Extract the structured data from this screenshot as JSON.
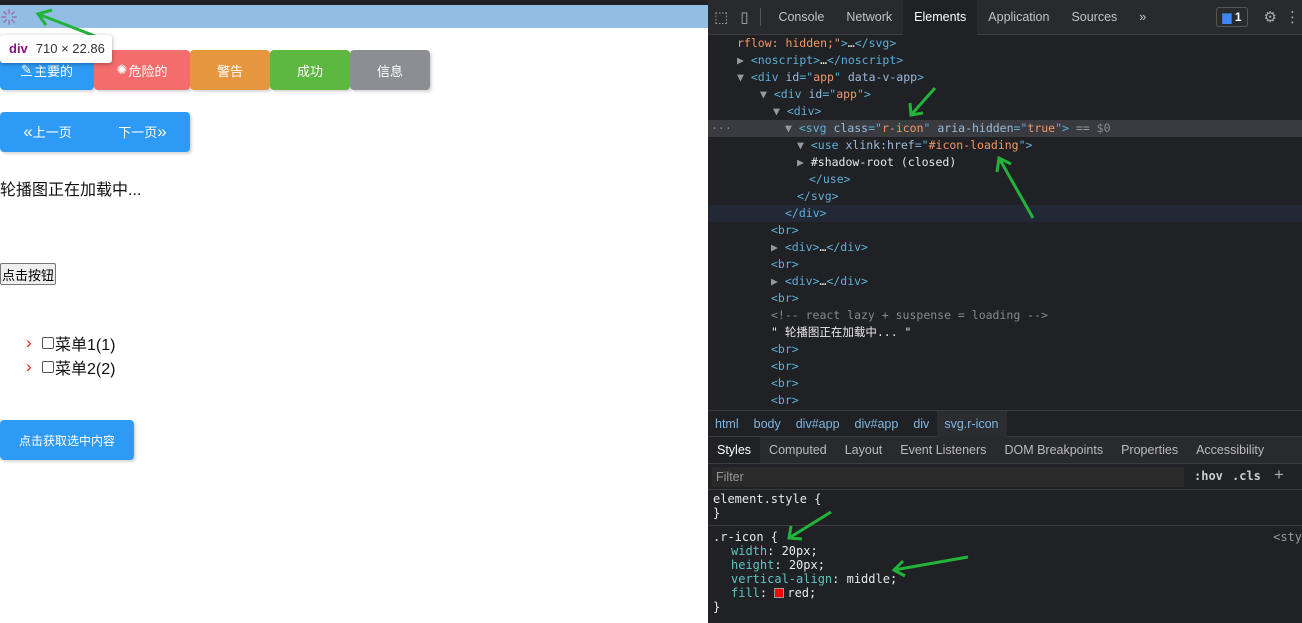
{
  "page": {
    "tooltip": {
      "tag": "div",
      "size": "710 × 22.86"
    },
    "buttons": [
      {
        "label": "主要的",
        "color": "#2d9bf5",
        "icon": "pencil-icon"
      },
      {
        "label": "危险的",
        "color": "#f56c6c",
        "icon": "loading-icon"
      },
      {
        "label": "警告",
        "color": "#e6963f"
      },
      {
        "label": "成功",
        "color": "#5cb840"
      },
      {
        "label": "信息",
        "color": "#8d8e93"
      }
    ],
    "pager": {
      "prev": "上一页",
      "next": "下一页"
    },
    "loading_text": "轮播图正在加载中...",
    "native_button": "点击按钮",
    "menu": [
      {
        "label": "菜单1(1)",
        "checked": false
      },
      {
        "label": "菜单2(2)",
        "checked": false
      }
    ],
    "get_button": "点击获取选中内容"
  },
  "devtools": {
    "tabs": [
      "Console",
      "Network",
      "Elements",
      "Application",
      "Sources"
    ],
    "active_tab": "Elements",
    "more": "»",
    "issues_count": "1",
    "tree": [
      [
        [
          "av",
          "rflow: hidden;\""
        ],
        [
          "tag",
          ">"
        ],
        [
          "tx",
          "…"
        ],
        [
          "tag",
          "</svg>"
        ]
      ],
      [
        [
          "mk",
          "▶ "
        ],
        [
          "tag",
          "<noscript>"
        ],
        [
          "tx",
          "…"
        ],
        [
          "tag",
          "</noscript>"
        ]
      ],
      [
        [
          "mk",
          "▼ "
        ],
        [
          "tag",
          "<div "
        ],
        [
          "an",
          "id"
        ],
        [
          "tag",
          "=\""
        ],
        [
          "av",
          "app"
        ],
        [
          "tag",
          "\" "
        ],
        [
          "an",
          "data-v-app"
        ],
        [
          "tag",
          ">"
        ]
      ],
      [
        [
          "mk",
          "▼ "
        ],
        [
          "tag",
          "<div "
        ],
        [
          "an",
          "id"
        ],
        [
          "tag",
          "=\""
        ],
        [
          "av",
          "app"
        ],
        [
          "tag",
          "\">"
        ]
      ],
      [
        [
          "mk",
          "▼ "
        ],
        [
          "tag",
          "<div>"
        ]
      ],
      [
        [
          "mk",
          "▼ "
        ],
        [
          "tag",
          "<svg "
        ],
        [
          "an",
          "class"
        ],
        [
          "tag",
          "=\""
        ],
        [
          "av",
          "r-icon"
        ],
        [
          "tag",
          "\" "
        ],
        [
          "an",
          "aria-hidden"
        ],
        [
          "tag",
          "=\""
        ],
        [
          "av",
          "true"
        ],
        [
          "tag",
          "\">"
        ],
        [
          "mk",
          " == "
        ],
        [
          "cm",
          "$0"
        ]
      ],
      [
        [
          "mk",
          "▼ "
        ],
        [
          "tag",
          "<use "
        ],
        [
          "an",
          "xlink:href"
        ],
        [
          "tag",
          "=\""
        ],
        [
          "av",
          "#icon-loading"
        ],
        [
          "tag",
          "\">"
        ]
      ],
      [
        [
          "mk",
          "▶ "
        ],
        [
          "tx",
          "#shadow-root (closed)"
        ]
      ],
      [
        [
          "tag",
          "</use>"
        ]
      ],
      [
        [
          "tag",
          "</svg>"
        ]
      ],
      [
        [
          "tag",
          "</div>"
        ]
      ],
      [
        [
          "tag",
          "<br>"
        ]
      ],
      [
        [
          "mk",
          "▶ "
        ],
        [
          "tag",
          "<div>"
        ],
        [
          "tx",
          "…"
        ],
        [
          "tag",
          "</div>"
        ]
      ],
      [
        [
          "tag",
          "<br>"
        ]
      ],
      [
        [
          "mk",
          "▶ "
        ],
        [
          "tag",
          "<div>"
        ],
        [
          "tx",
          "…"
        ],
        [
          "tag",
          "</div>"
        ]
      ],
      [
        [
          "tag",
          "<br>"
        ]
      ],
      [
        [
          "cm",
          "<!-- react lazy + suspense = loading -->"
        ]
      ],
      [
        [
          "tx",
          "\" 轮播图正在加载中... \""
        ]
      ],
      [
        [
          "tag",
          "<br>"
        ]
      ],
      [
        [
          "tag",
          "<br>"
        ]
      ],
      [
        [
          "tag",
          "<br>"
        ]
      ],
      [
        [
          "tag",
          "<br>"
        ]
      ]
    ],
    "breadcrumbs": [
      "html",
      "body",
      "div#app",
      "div#app",
      "div",
      "svg.r-icon"
    ],
    "style_tabs": [
      "Styles",
      "Computed",
      "Layout",
      "Event Listeners",
      "DOM Breakpoints",
      "Properties",
      "Accessibility"
    ],
    "filter_placeholder": "Filter",
    "hov": ":hov",
    "cls": ".cls",
    "element_style": "element.style {",
    "close_brace": "}",
    "rule": {
      "selector": ".r-icon {",
      "source": "<sty",
      "props": [
        {
          "name": "width",
          "value": "20px;"
        },
        {
          "name": "height",
          "value": "20px;"
        },
        {
          "name": "vertical-align",
          "value": "middle;"
        },
        {
          "name": "fill",
          "value": "red;",
          "swatch": "#ff0000"
        }
      ]
    }
  },
  "colors": {
    "highlight": "#93bee3",
    "annotation_arrow": "#22b33a"
  }
}
